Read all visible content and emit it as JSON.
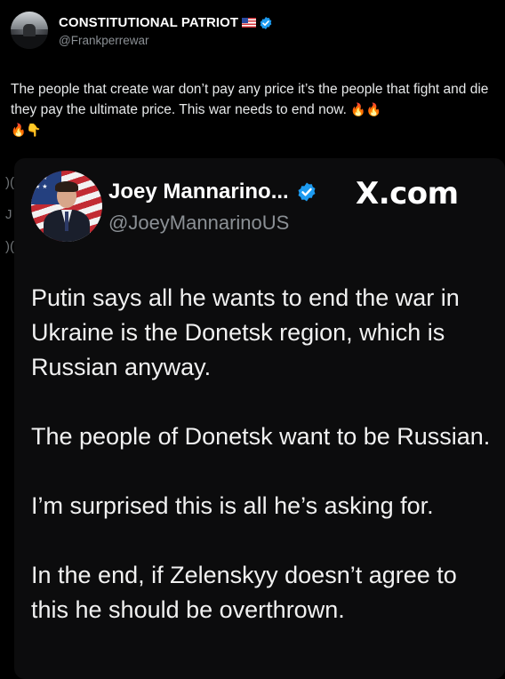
{
  "tweet": {
    "author_name": "CONSTITUTIONAL PATRIOT",
    "author_handle": "@Frankperrewar",
    "text": "The people that create war don’t pay any price it’s the people that fight and die they pay the ultimate price. This war needs to end now.",
    "emojis_line1": "🔥🔥",
    "emojis_line2": "🔥👇"
  },
  "background_fragments": [
    ")(",
    "J",
    ")("
  ],
  "embedded": {
    "author_name": "Joey Mannarino...",
    "author_handle": "@JoeyMannarinoUS",
    "site_label": "X.com",
    "paragraphs": [
      "Putin says all he wants to end the war in Ukraine is the Donetsk region, which is Russian anyway.",
      "The people of Donetsk want to be Russian.",
      "I’m surprised this is all he’s asking for.",
      "In the end, if Zelenskyy doesn’t agree to this he should be overthrown."
    ]
  },
  "icons": {
    "verified": "verified-badge-icon",
    "flag": "us-flag-icon"
  },
  "colors": {
    "background": "#000000",
    "verified_blue": "#1d9bf0",
    "muted_text": "#8b9095"
  }
}
